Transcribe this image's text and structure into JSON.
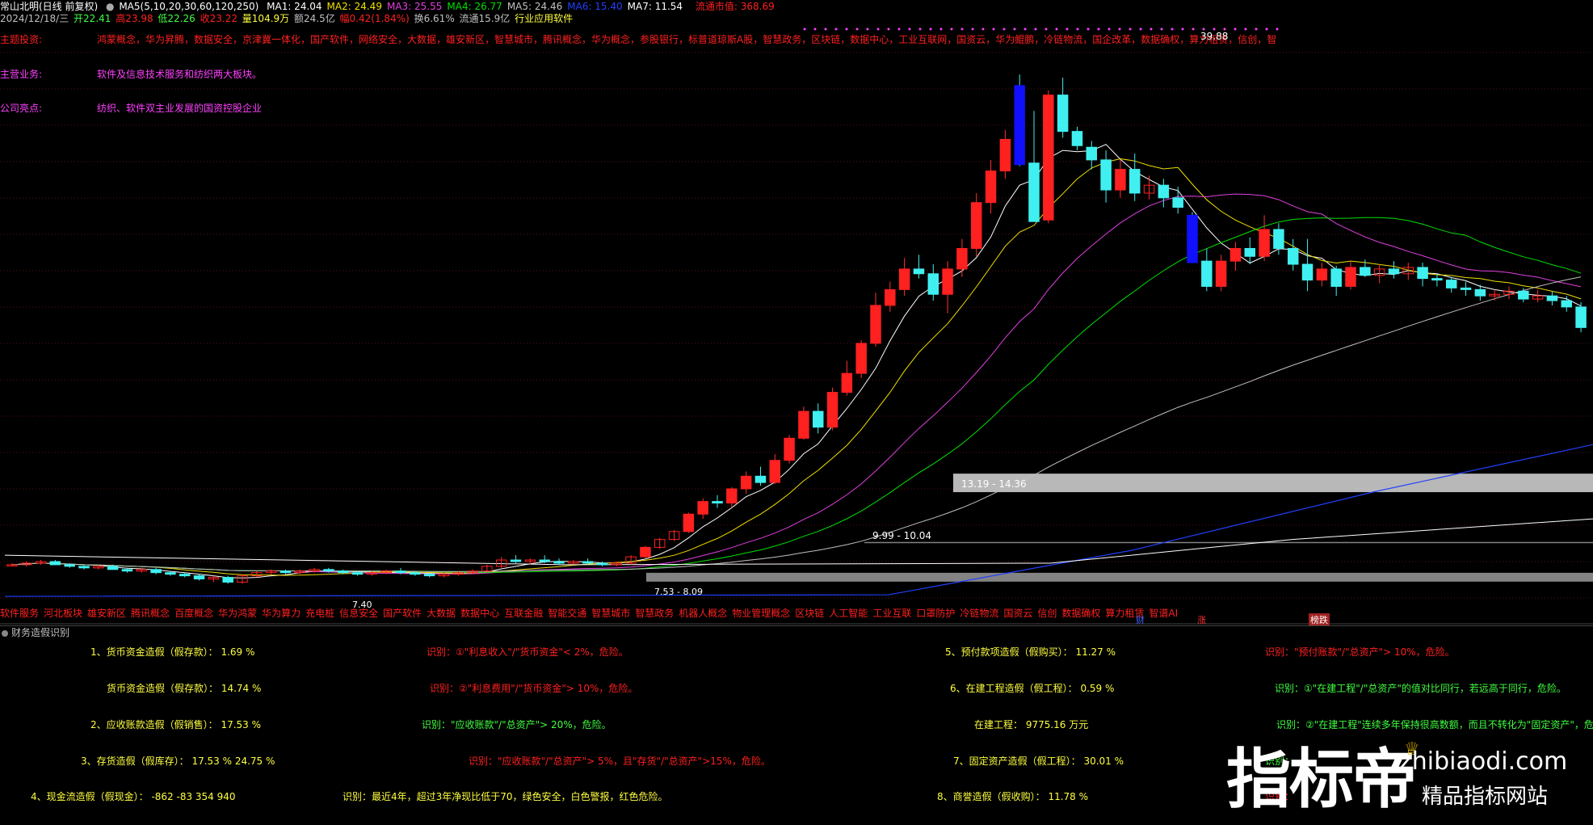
{
  "header": {
    "stock": "常山北明(日线 前复权)",
    "ma_param": "MA5(5,10,20,30,60,120,250)",
    "ma": [
      {
        "label": "MA1: 24.04",
        "color": "#ffffff"
      },
      {
        "label": "MA2: 24.49",
        "color": "#f0e000"
      },
      {
        "label": "MA3: 25.55",
        "color": "#e040e0"
      },
      {
        "label": "MA4: 26.77",
        "color": "#00e000"
      },
      {
        "label": "MA5: 24.46",
        "color": "#c0c0c0"
      },
      {
        "label": "MA6: 15.40",
        "color": "#2040ff"
      },
      {
        "label": "MA7: 11.54",
        "color": "#ffffff"
      }
    ],
    "mktcap_label": "流通市值: 368.69",
    "date": "2024/12/18/三",
    "open": "开22.41",
    "high": "高23.98",
    "low": "低22.26",
    "close": "收23.22",
    "volume": "量104.9万",
    "amount": "额24.5亿",
    "change": "幅0.42(1.84%)",
    "turnover": "换6.61%",
    "float": "流通15.9亿",
    "industry": "行业应用软件"
  },
  "tags": [
    {
      "label": "主题投资:",
      "text": "鸿蒙概念，华为昇腾，数据安全，京津冀一体化，国产软件，网络安全，大数据，雄安新区，智慧城市，腾讯概念，华为概念，参股银行，标普道琼斯A股，智慧政务，区块链，数据中心，工业互联网，国资云，华为鲲鹏，冷链物流，国企改革，数据确权，算力租赁，信创，智"
    },
    {
      "label": "主营业务:",
      "text": "软件及信息技术服务和纺织两大板块。"
    },
    {
      "label": "公司亮点:",
      "text": "纺织、软件双主业发展的国资控股企业"
    }
  ],
  "price_marks": {
    "peak": "39.88",
    "band1": "13.19 - 14.36",
    "band2": "9.99 - 10.04",
    "band3": "7.53 - 8.09",
    "low": "7.40"
  },
  "chart_data": {
    "type": "candlestick",
    "y_range": [
      6.5,
      41.5
    ],
    "candles": [
      [
        8.6,
        8.7,
        8.5,
        8.6
      ],
      [
        8.6,
        8.8,
        8.5,
        8.7
      ],
      [
        8.7,
        8.9,
        8.6,
        8.8
      ],
      [
        8.8,
        8.9,
        8.6,
        8.6
      ],
      [
        8.6,
        8.7,
        8.4,
        8.5
      ],
      [
        8.5,
        8.6,
        8.3,
        8.4
      ],
      [
        8.4,
        8.6,
        8.3,
        8.5
      ],
      [
        8.5,
        8.6,
        8.3,
        8.3
      ],
      [
        8.3,
        8.4,
        8.1,
        8.2
      ],
      [
        8.2,
        8.4,
        8.1,
        8.3
      ],
      [
        8.3,
        8.4,
        8.0,
        8.1
      ],
      [
        8.1,
        8.2,
        7.9,
        8.0
      ],
      [
        8.0,
        8.1,
        7.8,
        7.9
      ],
      [
        7.9,
        8.0,
        7.6,
        7.7
      ],
      [
        7.7,
        7.9,
        7.5,
        7.8
      ],
      [
        7.8,
        7.9,
        7.4,
        7.5
      ],
      [
        7.5,
        8.0,
        7.4,
        7.9
      ],
      [
        7.9,
        8.2,
        7.8,
        8.1
      ],
      [
        8.1,
        8.3,
        8.0,
        8.2
      ],
      [
        8.2,
        8.3,
        8.0,
        8.1
      ],
      [
        8.1,
        8.3,
        8.0,
        8.2
      ],
      [
        8.2,
        8.4,
        8.1,
        8.3
      ],
      [
        8.3,
        8.4,
        8.1,
        8.2
      ],
      [
        8.2,
        8.3,
        8.0,
        8.1
      ],
      [
        8.1,
        8.2,
        7.9,
        8.0
      ],
      [
        8.0,
        8.2,
        7.9,
        8.1
      ],
      [
        8.1,
        8.3,
        8.0,
        8.2
      ],
      [
        8.2,
        8.4,
        8.0,
        8.1
      ],
      [
        8.1,
        8.2,
        7.9,
        8.0
      ],
      [
        8.0,
        8.1,
        7.8,
        7.9
      ],
      [
        7.9,
        8.1,
        7.8,
        8.0
      ],
      [
        8.0,
        8.2,
        7.9,
        8.1
      ],
      [
        8.1,
        8.3,
        8.0,
        8.2
      ],
      [
        8.2,
        8.6,
        8.1,
        8.5
      ],
      [
        8.5,
        9.1,
        8.4,
        8.9
      ],
      [
        8.9,
        9.2,
        8.7,
        8.8
      ],
      [
        8.8,
        9.0,
        8.6,
        8.9
      ],
      [
        8.9,
        9.2,
        8.7,
        8.8
      ],
      [
        8.8,
        9.0,
        8.6,
        8.7
      ],
      [
        8.7,
        8.9,
        8.6,
        8.8
      ],
      [
        8.8,
        9.0,
        8.6,
        8.7
      ],
      [
        8.7,
        8.8,
        8.5,
        8.6
      ],
      [
        8.6,
        8.8,
        8.5,
        8.7
      ],
      [
        8.7,
        9.2,
        8.6,
        9.1
      ],
      [
        9.1,
        9.8,
        9.0,
        9.7
      ],
      [
        9.7,
        10.3,
        9.6,
        10.2
      ],
      [
        10.2,
        10.8,
        10.1,
        10.7
      ],
      [
        10.7,
        11.9,
        10.6,
        11.8
      ],
      [
        11.8,
        12.8,
        11.5,
        12.6
      ],
      [
        12.6,
        13.0,
        12.2,
        12.5
      ],
      [
        12.5,
        13.5,
        12.2,
        13.4
      ],
      [
        13.4,
        14.5,
        13.1,
        14.2
      ],
      [
        14.2,
        14.8,
        13.6,
        13.8
      ],
      [
        13.8,
        15.6,
        13.7,
        15.2
      ],
      [
        15.2,
        16.8,
        15.0,
        16.6
      ],
      [
        16.6,
        18.6,
        16.5,
        18.3
      ],
      [
        18.3,
        18.8,
        16.9,
        17.3
      ],
      [
        17.3,
        19.8,
        17.1,
        19.5
      ],
      [
        19.5,
        21.5,
        19.3,
        20.7
      ],
      [
        20.7,
        22.8,
        20.4,
        22.6
      ],
      [
        22.6,
        25.8,
        22.4,
        25.0
      ],
      [
        25.0,
        26.5,
        24.6,
        26.0
      ],
      [
        26.0,
        28.0,
        25.6,
        27.3
      ],
      [
        27.3,
        28.2,
        26.7,
        27.0
      ],
      [
        27.0,
        27.6,
        25.3,
        25.7
      ],
      [
        25.7,
        27.8,
        24.5,
        27.3
      ],
      [
        27.3,
        29.2,
        26.8,
        28.6
      ],
      [
        28.6,
        32.1,
        28.1,
        31.5
      ],
      [
        31.5,
        34.2,
        30.8,
        33.5
      ],
      [
        33.5,
        36.1,
        33.0,
        35.5
      ],
      [
        38.9,
        39.6,
        33.8,
        33.9
      ],
      [
        34.0,
        37.3,
        30.3,
        30.3
      ],
      [
        30.4,
        38.6,
        30.2,
        38.3
      ],
      [
        38.3,
        39.4,
        35.6,
        36.0
      ],
      [
        36.0,
        36.3,
        34.8,
        35.1
      ],
      [
        35.0,
        35.4,
        33.6,
        34.2
      ],
      [
        34.2,
        34.8,
        31.5,
        32.3
      ],
      [
        32.3,
        34.2,
        31.8,
        33.6
      ],
      [
        33.6,
        34.6,
        31.6,
        32.1
      ],
      [
        32.1,
        33.2,
        31.7,
        32.6
      ],
      [
        32.6,
        33.0,
        31.2,
        31.8
      ],
      [
        31.8,
        32.5,
        30.8,
        31.2
      ],
      [
        30.7,
        30.9,
        27.7,
        27.7
      ],
      [
        27.8,
        28.6,
        25.9,
        26.2
      ],
      [
        26.2,
        28.2,
        25.9,
        27.8
      ],
      [
        27.8,
        29.0,
        27.2,
        28.6
      ],
      [
        28.6,
        29.3,
        27.6,
        28.1
      ],
      [
        28.1,
        30.7,
        27.8,
        29.8
      ],
      [
        29.8,
        30.2,
        28.2,
        28.6
      ],
      [
        28.6,
        29.2,
        27.2,
        27.6
      ],
      [
        27.6,
        29.2,
        25.9,
        26.6
      ],
      [
        26.6,
        27.7,
        26.2,
        27.3
      ],
      [
        27.3,
        27.5,
        25.6,
        26.2
      ],
      [
        26.2,
        27.8,
        26.0,
        27.4
      ],
      [
        27.4,
        27.9,
        26.8,
        26.9
      ],
      [
        26.9,
        27.6,
        26.4,
        27.3
      ],
      [
        27.3,
        27.8,
        26.7,
        27.0
      ],
      [
        27.0,
        27.7,
        26.6,
        27.4
      ],
      [
        27.4,
        27.7,
        26.2,
        26.7
      ],
      [
        26.7,
        27.0,
        26.2,
        26.6
      ],
      [
        26.6,
        26.8,
        25.8,
        26.1
      ],
      [
        26.1,
        26.5,
        25.6,
        26.0
      ],
      [
        26.0,
        26.3,
        25.3,
        25.6
      ],
      [
        25.6,
        26.0,
        25.3,
        25.7
      ],
      [
        25.7,
        26.2,
        25.4,
        25.9
      ],
      [
        25.9,
        26.1,
        25.2,
        25.4
      ],
      [
        25.4,
        26.0,
        25.2,
        25.6
      ],
      [
        25.6,
        25.9,
        25.0,
        25.3
      ],
      [
        25.3,
        25.6,
        24.6,
        24.9
      ],
      [
        24.9,
        25.2,
        23.3,
        23.6
      ]
    ],
    "price_bands": [
      [
        13.19,
        14.36
      ],
      [
        9.99,
        10.04
      ],
      [
        7.53,
        8.09
      ]
    ]
  },
  "bottom_concepts": [
    "软件服务",
    "河北板块",
    "雄安新区",
    "腾讯概念",
    "百度概念",
    "华为鸿蒙",
    "华为算力",
    "充电桩",
    "信息安全",
    "国产软件",
    "大数据",
    "数据中心",
    "互联金融",
    "智能交通",
    "智慧城市",
    "智慧政务",
    "机器人概念",
    "物业管理概念",
    "区块链",
    "人工智能",
    "工业互联",
    "口罩防护",
    "冷链物流",
    "国资云",
    "信创",
    "数据确权",
    "算力租赁",
    "智谱AI"
  ],
  "bottom_badges": [
    {
      "label": "财",
      "color": "#4060ff",
      "bg": ""
    },
    {
      "label": "涨",
      "color": "#ff3030",
      "bg": ""
    },
    {
      "label": "榜跌",
      "color": "#ffffff",
      "bg": "#a02020"
    }
  ],
  "panel_title": "财务造假识别",
  "fin_rows": [
    {
      "left": "1、货币资金造假（假存款）： 1.69 %",
      "left_color": "#ffff40",
      "mid": "识别：①\"利息收入\"/\"货币资金\"< 2%，危险。",
      "mid_color": "#ff2020",
      "r1": "5、预付款项造假（假购买）： 11.27 %",
      "r1_color": "#ffff40",
      "r2": "识别：\"预付账款\"/\"总资产\"> 10%，危险。",
      "r2_color": "#ff2020"
    },
    {
      "left": "货币资金造假（假存款）： 14.74 %",
      "left_color": "#ffff40",
      "mid": "识别：②\"利息费用\"/\"货币资金\"> 10%，危险。",
      "mid_color": "#ff2020",
      "r1": "6、在建工程造假（假工程）： 0.59 %",
      "r1_color": "#ffff40",
      "r2": "识别：①\"在建工程\"/\"总资产\"的值对比同行，若远高于同行，危险。",
      "r2_color": "#40ff40"
    },
    {
      "left": "2、应收账款造假（假销售）： 17.53 %",
      "left_color": "#ffff40",
      "mid": "识别：\"应收账款\"/\"总资产\"> 20%，危险。",
      "mid_color": "#40ff40",
      "r1": "在建工程： 9775.16 万元",
      "r1_color": "#ffff40",
      "r2": "识别：②\"在建工程\"连续多年保持很高数额，而且不转化为\"固定资产\"，危",
      "r2_color": "#40ff40"
    },
    {
      "left": "3、存货造假（假库存）： 17.53 %     24.75 %",
      "left_color": "#ffff40",
      "mid": "识别：\"应收账款\"/\"总资产\"> 5%，且\"存货\"/\"总资产\">15%，危险。",
      "mid_color": "#ff2020",
      "r1": "7、固定资产造假（假工程）： 30.01 %",
      "r1_color": "#ffff40",
      "r2": "识别：",
      "r2_color": "#40ff40"
    },
    {
      "left": "4、现金流造假（假现金）： -862 -83 354 940",
      "left_color": "#ffff40",
      "mid": "识别：最近4年，超过3年净现比低于70，绿色安全，白色警报，红色危险。",
      "mid_color": "#ffff40",
      "r1": "8、商誉造假（假收购）： 11.78 %",
      "r1_color": "#ffff40",
      "r2": "识别：",
      "r2_color": "#ff2020"
    }
  ],
  "watermark": {
    "big": "指标帝",
    "url": "zhibiaodi.com",
    "sub": "精品指标网站"
  }
}
